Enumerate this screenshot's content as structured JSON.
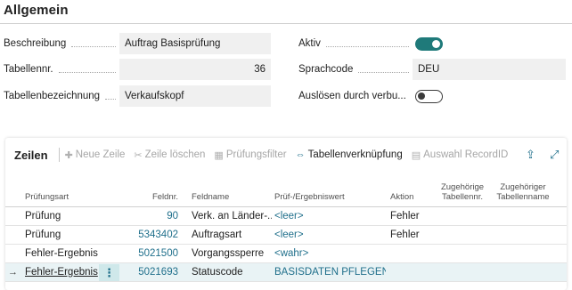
{
  "section": {
    "title": "Allgemein"
  },
  "fields_left": [
    {
      "label": "Beschreibung",
      "value": "Auftrag Basisprüfung"
    },
    {
      "label": "Tabellennr.",
      "value": "36"
    },
    {
      "label": "Tabellenbezeichnung",
      "value": "Verkaufskopf"
    }
  ],
  "fields_right": [
    {
      "label": "Aktiv",
      "value": "on"
    },
    {
      "label": "Sprachcode",
      "value": "DEU"
    },
    {
      "label": "Auslösen durch verbu...",
      "value": "off"
    }
  ],
  "lines": {
    "title": "Zeilen",
    "actions": [
      {
        "label": "Neue Zeile",
        "icon": "new-line-icon",
        "enabled": false
      },
      {
        "label": "Zeile löschen",
        "icon": "delete-line-icon",
        "enabled": false
      },
      {
        "label": "Prüfungsfilter",
        "icon": "filter-table-icon",
        "enabled": false
      },
      {
        "label": "Tabellenverknüpfung",
        "icon": "link-table-icon",
        "enabled": true
      },
      {
        "label": "Auswahl RecordID",
        "icon": "record-id-icon",
        "enabled": false
      }
    ],
    "right_icons": [
      "share-icon",
      "expand-icon"
    ],
    "columns": [
      {
        "line1": "Prüfungsart",
        "line2": ""
      },
      {
        "line1": "Feldnr.",
        "line2": ""
      },
      {
        "line1": "Feldname",
        "line2": ""
      },
      {
        "line1": "Prüf-/Ergebniswert",
        "line2": ""
      },
      {
        "line1": "Aktion",
        "line2": ""
      },
      {
        "line1": "Zugehörige",
        "line2": "Tabellennr."
      },
      {
        "line1": "Zugehöriger",
        "line2": "Tabellenname"
      }
    ],
    "rows": [
      {
        "art": "Prüfung",
        "feldnr": "90",
        "feldname": "Verk. an Länder-...",
        "wert": "<leer>",
        "aktion": "Fehler",
        "tabnr": "",
        "tabname": "",
        "selected": false
      },
      {
        "art": "Prüfung",
        "feldnr": "5343402",
        "feldname": "Auftragsart",
        "wert": "<leer>",
        "aktion": "Fehler",
        "tabnr": "",
        "tabname": "",
        "selected": false
      },
      {
        "art": "Fehler-Ergebnis",
        "feldnr": "5021500",
        "feldname": "Vorgangssperre",
        "wert": "<wahr>",
        "aktion": "",
        "tabnr": "",
        "tabname": "",
        "selected": false
      },
      {
        "art": "Fehler-Ergebnis",
        "feldnr": "5021693",
        "feldname": "Statuscode",
        "wert": "BASISDATEN PFLEGEN",
        "aktion": "",
        "tabnr": "",
        "tabname": "",
        "selected": true
      }
    ],
    "row_menu_glyph": "⋮",
    "row_arrow_glyph": "→"
  },
  "colors": {
    "accent": "#1f6f8b",
    "toggle_on": "#1f7a7a",
    "field_bg": "#f0f0f0",
    "selected_row": "#e9f3f5"
  }
}
